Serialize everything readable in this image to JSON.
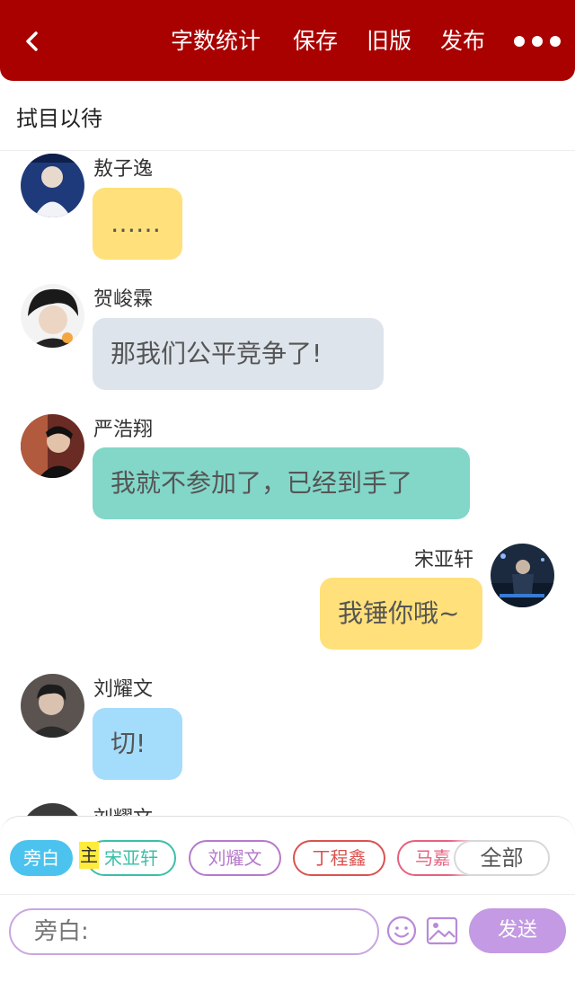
{
  "header": {
    "word_count": "字数统计",
    "save": "保存",
    "old_version": "旧版",
    "publish": "发布"
  },
  "title": "拭目以待",
  "messages": [
    {
      "name": "敖子逸",
      "text": "……"
    },
    {
      "name": "贺峻霖",
      "text": "那我们公平竞争了!"
    },
    {
      "name": "严浩翔",
      "text": "我就不参加了，已经到手了"
    },
    {
      "name": "宋亚轩",
      "text": "我锤你哦~"
    },
    {
      "name": "刘耀文",
      "text": "切!"
    },
    {
      "name": "刘耀文"
    }
  ],
  "bubble_colors": [
    "#ffe07a",
    "#dde4ec",
    "#83d7c9",
    "#ffe07a",
    "#a4dcfb"
  ],
  "characters": {
    "narrator": "旁白",
    "main_tag": "主",
    "items": [
      "宋亚轩",
      "刘耀文",
      "丁程鑫",
      "马嘉"
    ],
    "all": "全部"
  },
  "composer": {
    "placeholder": "旁白:",
    "send": "发送",
    "icons": [
      "emoji-icon",
      "image-icon"
    ]
  },
  "colors": {
    "header": "#a90000",
    "narrator_chip": "#4cc3ee",
    "send": "#c39ae3"
  }
}
